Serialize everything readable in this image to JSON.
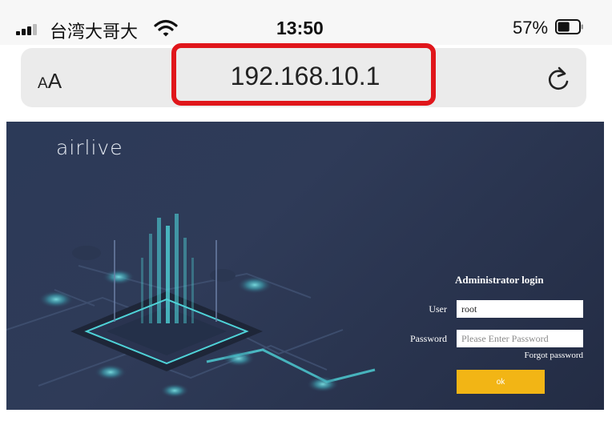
{
  "status_bar": {
    "carrier": "台湾大哥大",
    "time": "13:50",
    "battery_percent": "57%",
    "battery_level": 0.57,
    "icons": [
      "signal-icon",
      "wifi-icon",
      "battery-icon"
    ]
  },
  "browser": {
    "text_size_button": {
      "small": "A",
      "large": "A"
    },
    "url": "192.168.10.1",
    "reload_icon": "reload-icon",
    "highlight_color": "#e0161b"
  },
  "page": {
    "logo": "airlive",
    "login": {
      "title": "Administrator login",
      "user_label": "User",
      "user_value": "root",
      "password_label": "Password",
      "password_placeholder": "Please Enter Password",
      "forgot_link": "Forgot password",
      "ok_button": "ok"
    },
    "colors": {
      "background": "#2c3a58",
      "button": "#f2b515",
      "accent_glow": "#4fd3d8"
    }
  }
}
